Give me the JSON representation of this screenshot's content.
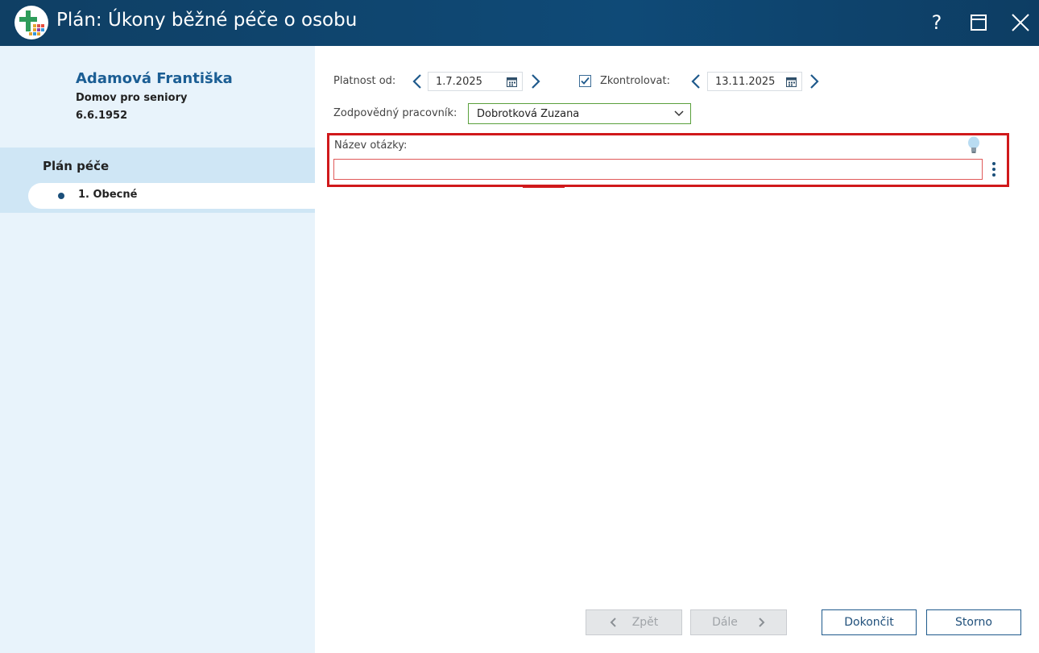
{
  "window": {
    "title": "Plán: Úkony běžné péče o osobu",
    "help_label": "?"
  },
  "person": {
    "name": "Adamová Františka",
    "facility": "Domov pro seniory",
    "dob": "6.6.1952"
  },
  "sidebar": {
    "section_title": "Plán péče",
    "items": [
      {
        "label": "1. Obecné",
        "active": true
      }
    ]
  },
  "form": {
    "valid_from_label": "Platnost od:",
    "valid_from_value": "1.7.2025",
    "check_label": "Zkontrolovat:",
    "check_checked": true,
    "check_value": "13.11.2025",
    "worker_label": "Zodpovědný pracovník:",
    "worker_value": "Dobrotková Zuzana",
    "question_label": "Název otázky:",
    "question_value": ""
  },
  "footer": {
    "back_label": "Zpět",
    "next_label": "Dále",
    "finish_label": "Dokončit",
    "cancel_label": "Storno"
  },
  "colors": {
    "titlebar": "#0f4a77",
    "accent": "#1b5e94",
    "sidebar_bg": "#e8f3fb",
    "section_bg": "#cfe6f5",
    "error": "#d0191b",
    "select_border": "#5aa03c"
  }
}
